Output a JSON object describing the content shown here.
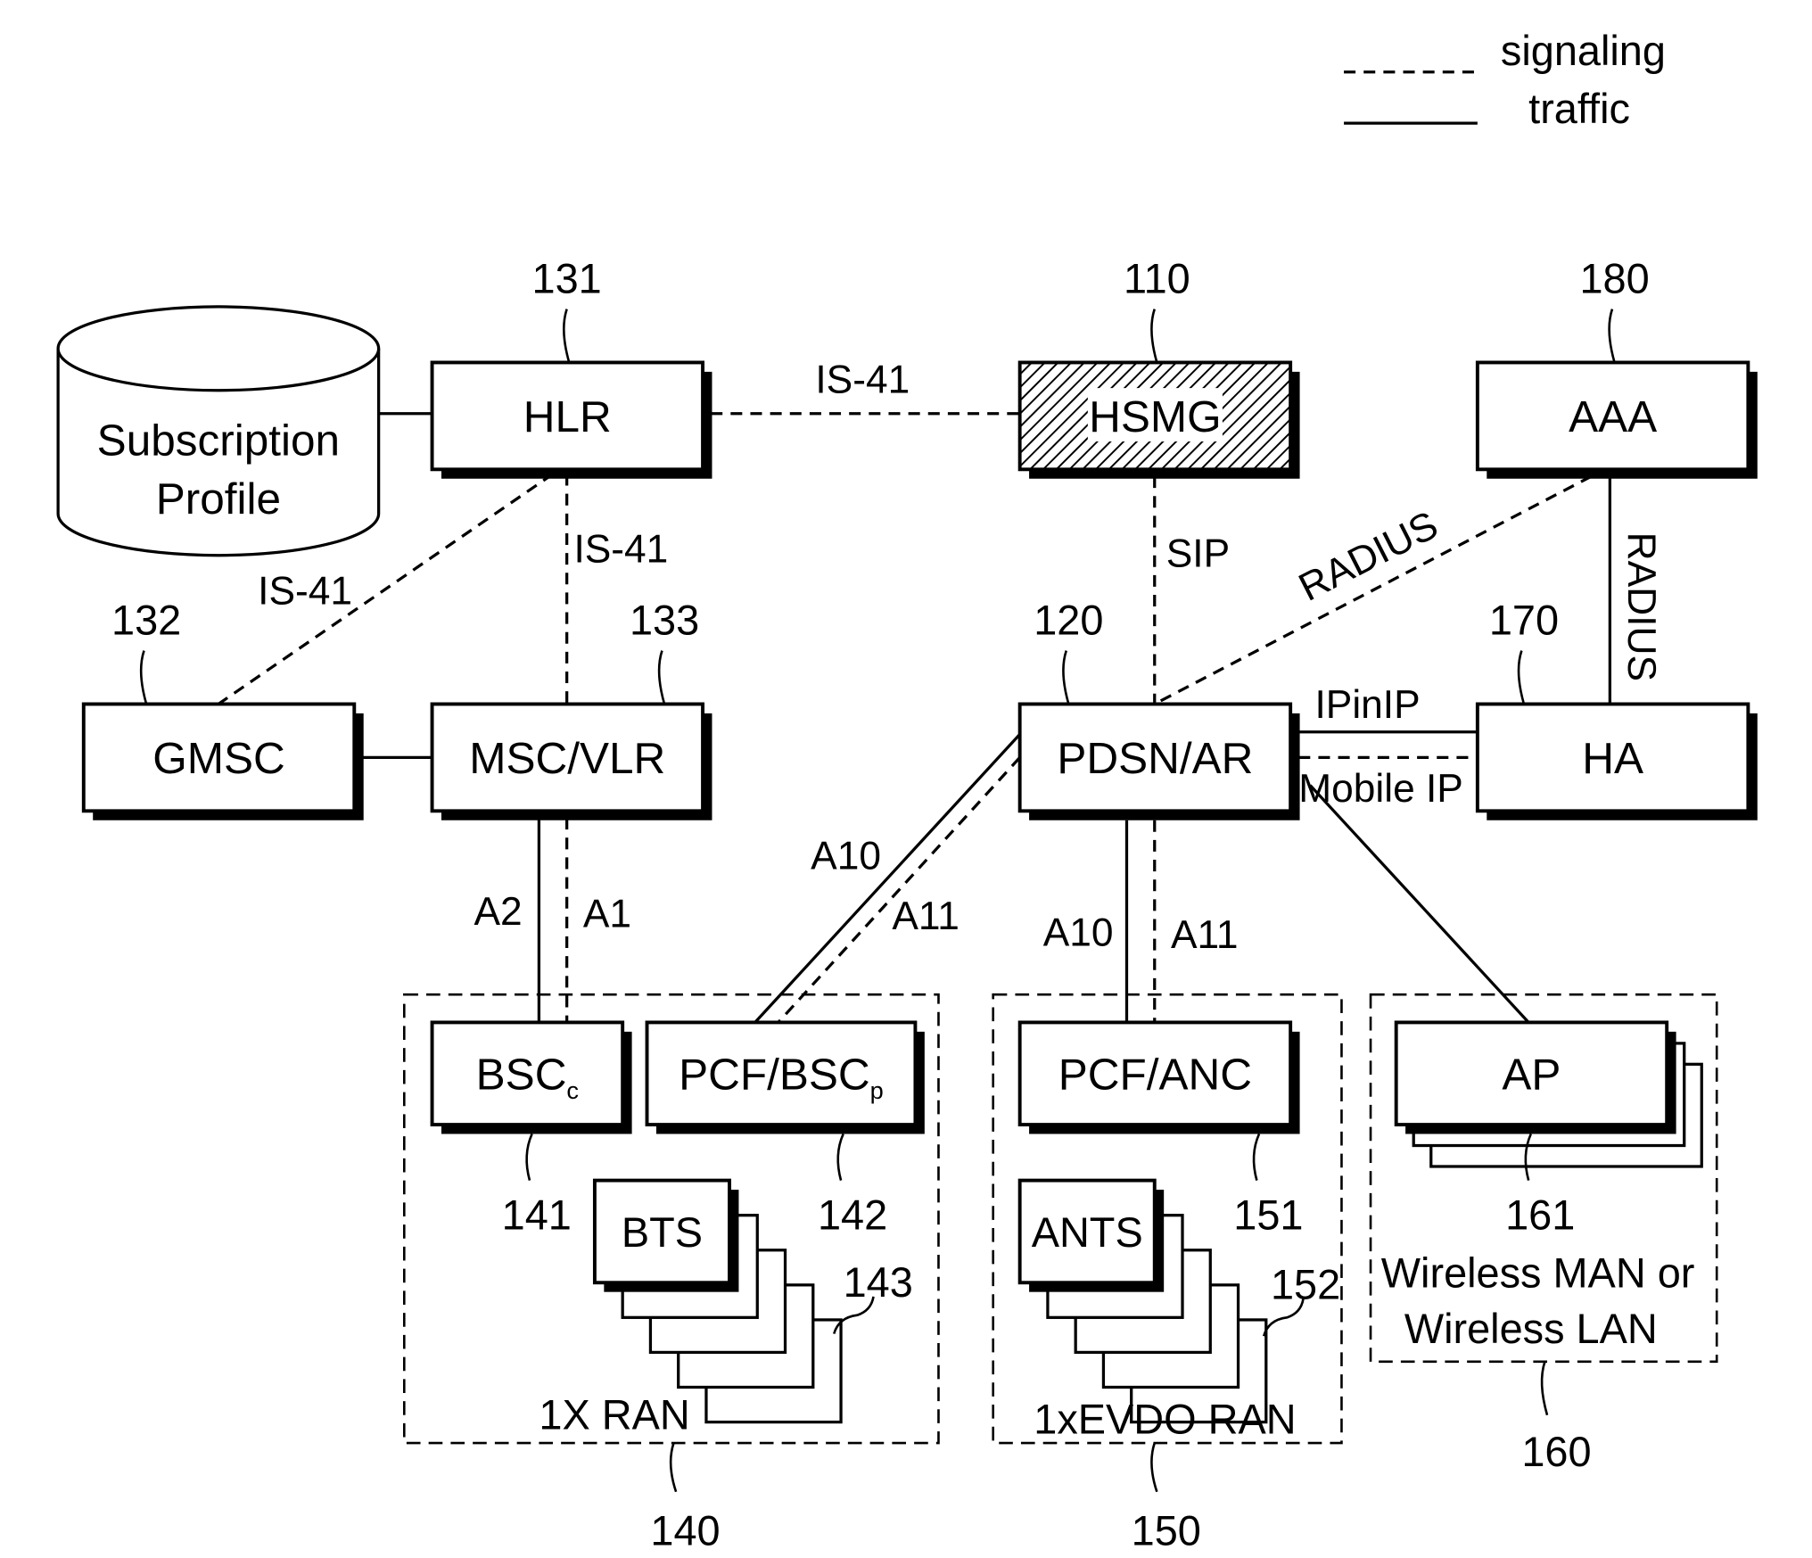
{
  "legend": {
    "signaling": "signaling",
    "traffic": "traffic"
  },
  "nodes": {
    "subscription_profile": {
      "line1": "Subscription",
      "line2": "Profile"
    },
    "hlr": {
      "label": "HLR",
      "ref": "131"
    },
    "hsmg": {
      "label": "HSMG",
      "ref": "110"
    },
    "aaa": {
      "label": "AAA",
      "ref": "180"
    },
    "gmsc": {
      "label": "GMSC",
      "ref": "132"
    },
    "msc_vlr": {
      "label": "MSC/VLR",
      "ref": "133"
    },
    "pdsn_ar": {
      "label": "PDSN/AR",
      "ref": "120"
    },
    "ha": {
      "label": "HA",
      "ref": "170"
    },
    "bsc_c": {
      "label": "BSC",
      "sub": "c",
      "ref": "141"
    },
    "pcf_bsc_p": {
      "label": "PCF/BSC",
      "sub": "p",
      "ref": "142"
    },
    "bts": {
      "label": "BTS",
      "ref": "143"
    },
    "pcf_anc": {
      "label": "PCF/ANC",
      "ref": "151"
    },
    "ants": {
      "label": "ANTS",
      "ref": "152"
    },
    "ap": {
      "label": "AP",
      "ref": "161"
    }
  },
  "groups": {
    "ran_1x": {
      "label": "1X RAN",
      "ref": "140"
    },
    "ran_evdo": {
      "label": "1xEVDO RAN",
      "ref": "150"
    },
    "wireless": {
      "line1": "Wireless MAN or",
      "line2": "Wireless LAN",
      "ref": "160"
    }
  },
  "links": {
    "hlr_hsmg": "IS-41",
    "hlr_msc": "IS-41",
    "hlr_gmsc": "IS-41",
    "hsmg_pdsn": "SIP",
    "aaa_pdsn": "RADIUS",
    "aaa_ha": "RADIUS",
    "pdsn_ha_traffic": "IPinIP",
    "pdsn_ha_signal": "Mobile IP",
    "msc_bsc_traffic": "A2",
    "msc_bsc_signal": "A1",
    "pdsn_pcfbsc_traffic": "A10",
    "pdsn_pcfbsc_signal": "A11",
    "pdsn_pcfanc_traffic": "A10",
    "pdsn_pcfanc_signal": "A11"
  }
}
